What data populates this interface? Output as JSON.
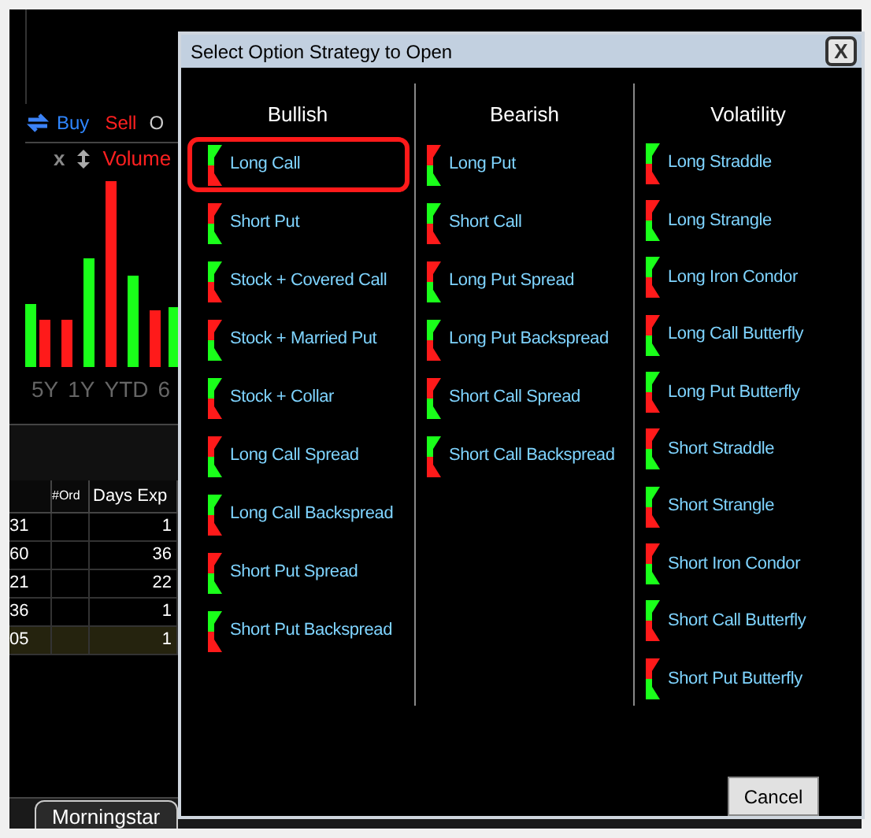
{
  "background": {
    "toolbar": {
      "buy": "Buy",
      "sell": "Sell",
      "cut_label": "O"
    },
    "chart_header": {
      "close": "x",
      "study": "Volume"
    },
    "ranges": [
      "5Y",
      "1Y",
      "YTD",
      "6"
    ],
    "table": {
      "columns": [
        "#Ord",
        "Days Exp"
      ],
      "rows": [
        {
          "column_1": "31",
          "days_exp": "1",
          "selected": false
        },
        {
          "column_1": "60",
          "days_exp": "36",
          "selected": false
        },
        {
          "column_1": "21",
          "days_exp": "22",
          "selected": false
        },
        {
          "column_1": "36",
          "days_exp": "1",
          "selected": false
        },
        {
          "column_1": "05",
          "days_exp": "1",
          "selected": true
        }
      ]
    },
    "bottom_tab": "Morningstar"
  },
  "dialog": {
    "title": "Select Option Strategy to Open",
    "close": "X",
    "columns": [
      {
        "heading": "Bullish",
        "items": [
          {
            "label": "Long Call",
            "selected": true
          },
          {
            "label": "Short Put",
            "selected": false
          },
          {
            "label": "Stock + Covered Call",
            "selected": false
          },
          {
            "label": "Stock + Married Put",
            "selected": false
          },
          {
            "label": "Stock + Collar",
            "selected": false
          },
          {
            "label": "Long Call Spread",
            "selected": false
          },
          {
            "label": "Long Call Backspread",
            "selected": false
          },
          {
            "label": "Short Put Spread",
            "selected": false
          },
          {
            "label": "Short Put Backspread",
            "selected": false
          }
        ]
      },
      {
        "heading": "Bearish",
        "items": [
          {
            "label": "Long Put",
            "selected": false
          },
          {
            "label": "Short Call",
            "selected": false
          },
          {
            "label": "Long Put Spread",
            "selected": false
          },
          {
            "label": "Long Put Backspread",
            "selected": false
          },
          {
            "label": "Short Call Spread",
            "selected": false
          },
          {
            "label": "Short Call Backspread",
            "selected": false
          }
        ]
      },
      {
        "heading": "Volatility",
        "items": [
          {
            "label": "Long Straddle",
            "selected": false
          },
          {
            "label": "Long Strangle",
            "selected": false
          },
          {
            "label": "Long Iron Condor",
            "selected": false
          },
          {
            "label": "Long Call Butterfly",
            "selected": false
          },
          {
            "label": "Long Put Butterfly",
            "selected": false
          },
          {
            "label": "Short Straddle",
            "selected": false
          },
          {
            "label": "Short Strangle",
            "selected": false
          },
          {
            "label": "Short Iron Condor",
            "selected": false
          },
          {
            "label": "Short Call Butterfly",
            "selected": false
          },
          {
            "label": "Short Put Butterfly",
            "selected": false
          }
        ]
      }
    ],
    "cancel": "Cancel"
  }
}
